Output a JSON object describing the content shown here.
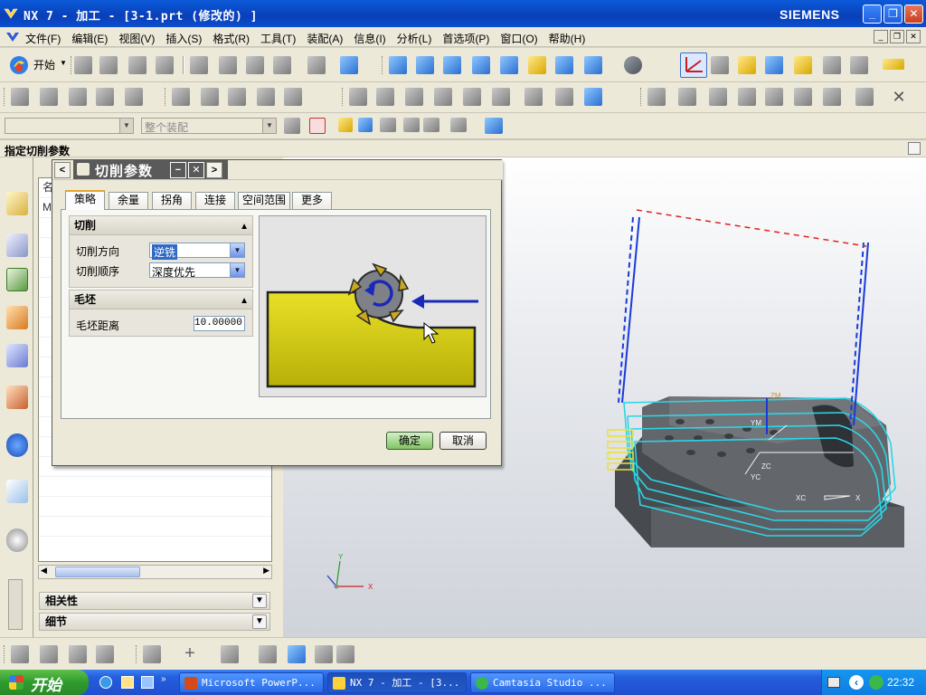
{
  "window": {
    "title": "NX 7 - 加工 - [3-1.prt (修改的) ]",
    "brand": "SIEMENS",
    "min_label": "_",
    "max_label": "❐",
    "close_label": "✕"
  },
  "menu": {
    "items": [
      "文件(F)",
      "编辑(E)",
      "视图(V)",
      "插入(S)",
      "格式(R)",
      "工具(T)",
      "装配(A)",
      "信息(I)",
      "分析(L)",
      "首选项(P)",
      "窗口(O)",
      "帮助(H)"
    ]
  },
  "toolbar": {
    "start_label": "开始",
    "assembly_placeholder": "整个装配"
  },
  "cue": "指定切削参数",
  "dialog": {
    "title": "切削参数",
    "tabs": [
      "策略",
      "余量",
      "拐角",
      "连接",
      "空间范围",
      "更多"
    ],
    "group_cut": {
      "title": "切削",
      "cut_direction_label": "切削方向",
      "cut_direction_value": "逆铣",
      "cut_order_label": "切削顺序",
      "cut_order_value": "深度优先"
    },
    "group_blank": {
      "title": "毛坯",
      "blank_distance_label": "毛坯距离",
      "blank_distance_value": "10.00000"
    },
    "ok_label": "确定",
    "cancel_label": "取消"
  },
  "navigator": {
    "col_header": "名",
    "first_row": "M",
    "sections": [
      "相关性",
      "细节"
    ]
  },
  "graphics": {
    "axis_labels": [
      "ZM",
      "YM",
      "ZC",
      "YC",
      "XC",
      "X",
      "Y",
      "X"
    ]
  },
  "taskbar": {
    "start_label": "开始",
    "tasks": [
      "Microsoft PowerP...",
      "NX 7 - 加工 - [3...",
      "Camtasia Studio ..."
    ],
    "clock": "22:32"
  },
  "colors": {
    "title_blue": "#0a3fb8",
    "blank_yellow": "#d4cd12",
    "tool_path_cyan": "#2ad6e6",
    "feed_arrow_blue": "#1a2ab8",
    "part_gray": "#55595e"
  }
}
